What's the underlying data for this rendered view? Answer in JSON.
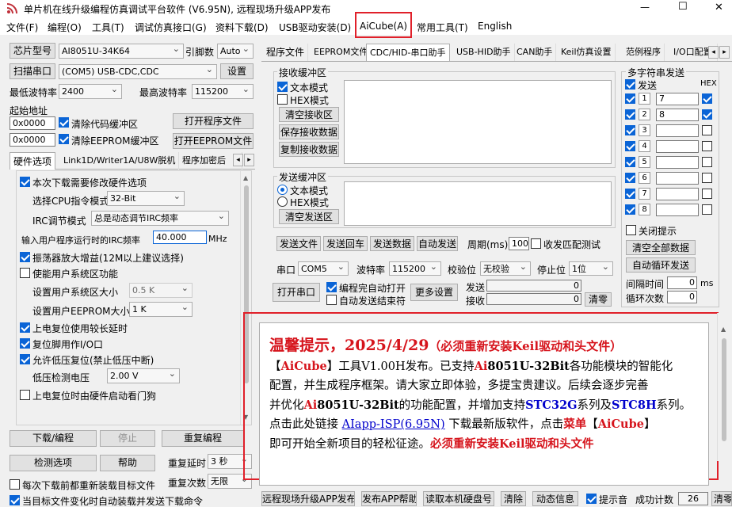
{
  "window": {
    "title": "单片机在线升级编程仿真调试平台软件 (V6.95N), 远程现场升级APP发布",
    "controls": [
      "—",
      "☐",
      "✕"
    ]
  },
  "menu": [
    "文件(F)",
    "编程(O)",
    "工具(T)",
    "调试仿真接口(G)",
    "资料下载(D)",
    "USB驱动安装(D)",
    "AiCube(A)",
    "常用工具(T)",
    "English"
  ],
  "left": {
    "chip_btn": "芯片型号",
    "chip_value": "AI8051U-34K64",
    "pin_label": "引脚数",
    "pin_value": "Auto",
    "scan_btn": "扫描串口",
    "port_value": "(COM5) USB-CDC,CDC",
    "settings_btn": "设置",
    "min_baud_label": "最低波特率",
    "min_baud": "2400",
    "max_baud_label": "最高波特率",
    "max_baud": "115200",
    "start_addr_label": "起始地址",
    "code_addr": "0x0000",
    "clear_code": "清除代码缓冲区",
    "open_prog": "打开程序文件",
    "eeprom_addr": "0x0000",
    "clear_eeprom": "清除EEPROM缓冲区",
    "open_eeprom": "打开EEPROM文件",
    "tabs": [
      "硬件选项",
      "Link1D/Writer1A/U8W脱机",
      "程序加密后"
    ],
    "hw": {
      "opt_modify": "本次下载需要修改硬件选项",
      "cpu_mode_label": "选择CPU指令模式",
      "cpu_mode": "32-Bit",
      "irc_label": "IRC调节模式",
      "irc_mode": "总是动态调节IRC频率",
      "freq_label": "输入用户程序运行时的IRC频率",
      "freq_value": "40.000",
      "freq_unit": "MHz",
      "osc_gain": "振荡器放大增益(12M以上建议选择)",
      "sys_area": "使能用户系统区功能",
      "sys_size_label": "设置用户系统区大小",
      "sys_size": "0.5 K",
      "eeprom_size_label": "设置用户EEPROM大小",
      "eeprom_size": "1   K",
      "long_delay": "上电复位使用较长延时",
      "reset_io": "复位脚用作I/O口",
      "lvd": "允许低压复位(禁止低压中断)",
      "lvd_label": "低压检测电压",
      "lvd_value": "2.00 V",
      "watchdog": "上电复位时由硬件启动看门狗"
    },
    "download_btn": "下载/编程",
    "stop_btn": "停止",
    "reprog_btn": "重复编程",
    "detect_btn": "检测选项",
    "help_btn": "帮助",
    "repeat_delay_label": "重复延时",
    "repeat_delay": "3 秒",
    "repeat_count_label": "重复次数",
    "repeat_count": "无限",
    "reload_each": "每次下载前都重新装载目标文件",
    "auto_load": "当目标文件变化时自动装载并发送下载命令"
  },
  "right_tabs": [
    "程序文件",
    "EEPROM文件",
    "CDC/HID-串口助手",
    "USB-HID助手",
    "CAN助手",
    "Keil仿真设置",
    "范例程序",
    "I/O口配置"
  ],
  "serial": {
    "recv_title": "接收缓冲区",
    "text_mode": "文本模式",
    "hex_mode": "HEX模式",
    "clear_recv": "清空接收区",
    "save_recv": "保存接收数据",
    "copy_recv": "复制接收数据",
    "send_title": "发送缓冲区",
    "send_text_mode": "文本模式",
    "send_hex_mode": "HEX模式",
    "clear_send": "清空发送区",
    "send_file": "发送文件",
    "send_return": "发送回车",
    "send_data": "发送数据",
    "auto_send": "自动发送",
    "period_label": "周期(ms)",
    "period": "100",
    "match_test": "收发匹配测试",
    "port_label": "串口",
    "port": "COM5",
    "baud_label": "波特率",
    "baud": "115200",
    "parity_label": "校验位",
    "parity": "无校验",
    "stop_label": "停止位",
    "stop": "1位",
    "open_port": "打开串口",
    "auto_open": "编程完自动打开",
    "auto_send_end": "自动发送结束符",
    "more_settings": "更多设置",
    "sent_label": "发送",
    "sent_count": "0",
    "recv_label": "接收",
    "recv_count": "0",
    "clear_count": "清零"
  },
  "multi": {
    "title": "多字符串发送",
    "send_col": "发送",
    "hex_col": "HEX",
    "rows": [
      {
        "n": "1",
        "val": "7",
        "hex": true
      },
      {
        "n": "2",
        "val": "8",
        "hex": true
      },
      {
        "n": "3",
        "val": "",
        "hex": false
      },
      {
        "n": "4",
        "val": "",
        "hex": false
      },
      {
        "n": "5",
        "val": "",
        "hex": false
      },
      {
        "n": "6",
        "val": "",
        "hex": false
      },
      {
        "n": "7",
        "val": "",
        "hex": false
      },
      {
        "n": "8",
        "val": "",
        "hex": false
      }
    ],
    "close_tip": "关闭提示",
    "clear_all": "清空全部数据",
    "auto_loop": "自动循环发送",
    "interval_label": "间隔时间",
    "interval": "0",
    "interval_unit": "ms",
    "loop_label": "循环次数",
    "loop": "0"
  },
  "notice": {
    "title": "温馨提示，2025/4/29",
    "title_note": "（必须重新安装Keil驱动和头文件）",
    "b1": "【",
    "aicube1": "AiCube",
    "b2": "】",
    "t1": "工具V1.00H发布。已支持",
    "ai1": "Ai",
    "t2": "8051U-32Bit",
    "t3": "各功能模块的智能化",
    "t4": "配置，并生成程序框架。请大家立即体验，多提宝贵建议。后续会逐步完善",
    "t5": "并优化",
    "ai2": "Ai",
    "t6": "8051U-32Bit",
    "t7": "的功能配置，并增加支持",
    "stc32g": "STC32G",
    "t8": "系列及",
    "stc8h": "STC8H",
    "t9": "系列。",
    "t10": "点击此处链接",
    "link": "AIapp-ISP(6.95N)",
    "t11": "下载最新版软件，点击",
    "menu_word": "菜单",
    "b3": "【",
    "aicube2": "AiCube",
    "b4": "】",
    "t12": "即可开始全新项目的轻松征途。",
    "must": "必须重新安装Keil驱动和头文件"
  },
  "bottom": {
    "remote_upgrade": "远程现场升级APP发布",
    "publish_help": "发布APP帮助",
    "read_disk": "读取本机硬盘号",
    "clear": "清除",
    "dynamic_info": "动态信息",
    "beep": "提示音",
    "success_label": "成功计数",
    "success_count": "26",
    "clear2": "清零"
  },
  "colors": {
    "highlight_red": "#e0202a",
    "notice_red": "#d6141c",
    "blue": "#0000cc",
    "accent": "#0a64d6"
  }
}
